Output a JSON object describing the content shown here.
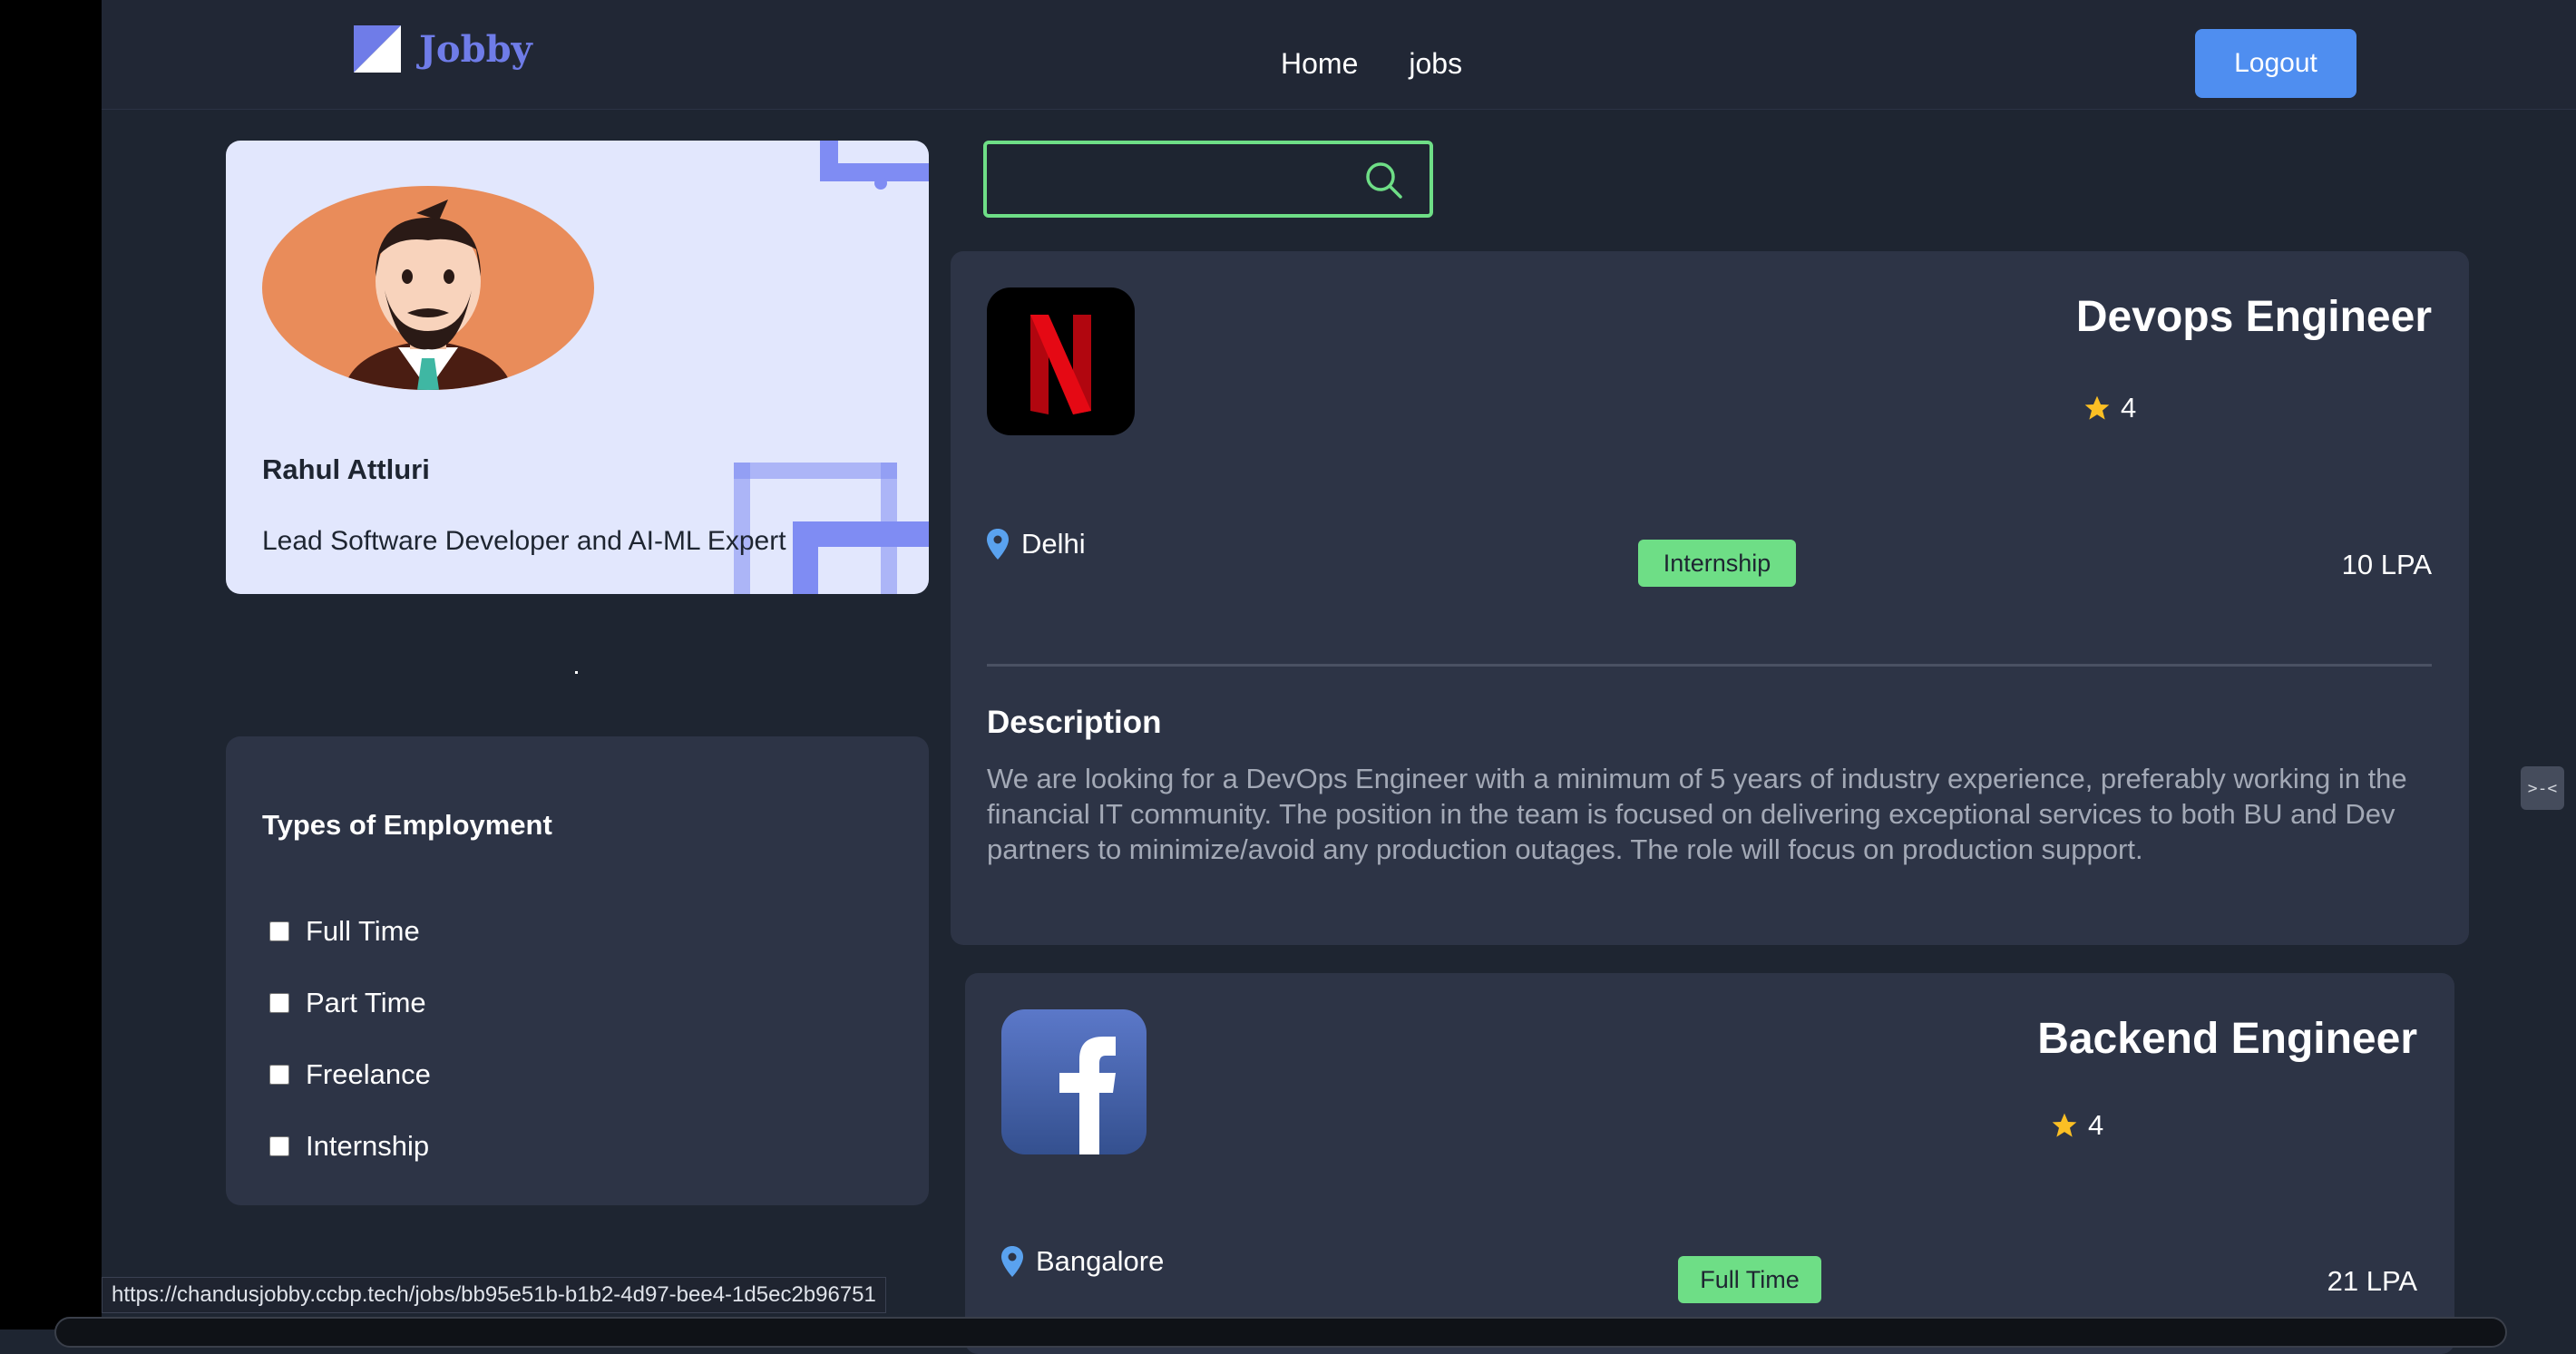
{
  "nav": {
    "brand": "Jobby",
    "links": [
      "Home",
      "jobs"
    ],
    "logout_label": "Logout"
  },
  "profile": {
    "name": "Rahul Attluri",
    "bio": "Lead Software Developer and AI-ML Expert"
  },
  "filters": {
    "title": "Types of Employment",
    "options": [
      "Full Time",
      "Part Time",
      "Freelance",
      "Internship"
    ]
  },
  "search": {
    "value": "",
    "placeholder": ""
  },
  "jobs": [
    {
      "company_icon": "netflix-logo-icon",
      "title": "Devops Engineer",
      "rating": "4",
      "location": "Delhi",
      "employment_type": "Internship",
      "package": "10 LPA",
      "description_heading": "Description",
      "description": "We are looking for a DevOps Engineer with a minimum of 5 years of industry experience, preferably working in the financial IT community. The position in the team is focused on delivering exceptional services to both BU and Dev partners to minimize/avoid any production outages. The role will focus on production support."
    },
    {
      "company_icon": "facebook-logo-icon",
      "title": "Backend Engineer",
      "rating": "4",
      "location": "Bangalore",
      "employment_type": "Full Time",
      "package": "21 LPA"
    }
  ],
  "status_url": "https://chandusjobby.ccbp.tech/jobs/bb95e51b-b1b2-4d97-bee4-1d5ec2b96751",
  "side_handle_label": ">-<",
  "colors": {
    "background": "#1e2531",
    "card": "#2d3446",
    "accent_blue": "#4f8ef0",
    "badge_green": "#6ede86",
    "star": "#fbbf24",
    "brand": "#6f7ce8"
  }
}
